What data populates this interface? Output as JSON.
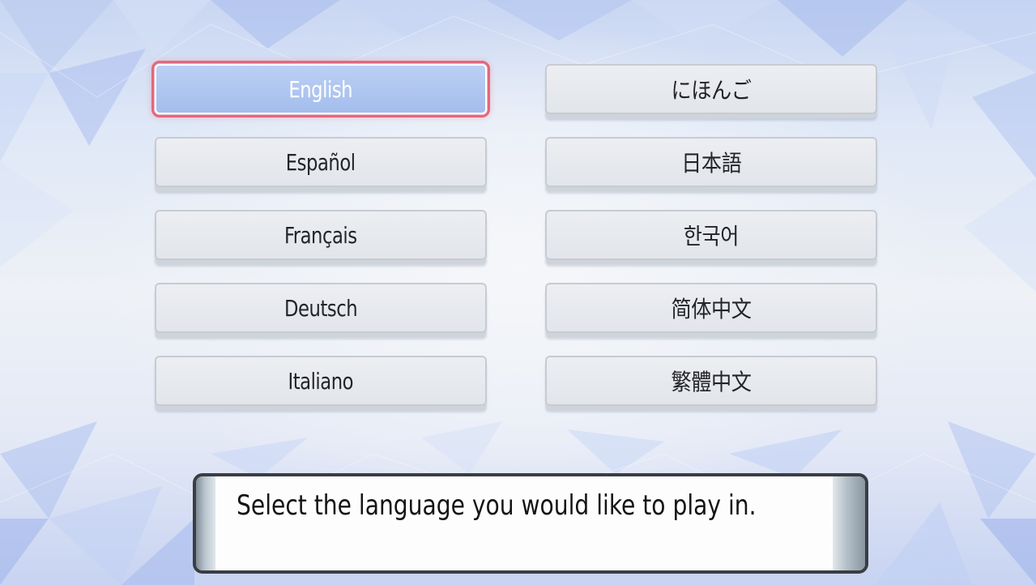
{
  "language_menu": {
    "left_column": [
      {
        "label": "English",
        "selected": true
      },
      {
        "label": "Español",
        "selected": false
      },
      {
        "label": "Français",
        "selected": false
      },
      {
        "label": "Deutsch",
        "selected": false
      },
      {
        "label": "Italiano",
        "selected": false
      }
    ],
    "right_column": [
      {
        "label": "にほんご",
        "selected": false
      },
      {
        "label": "日本語",
        "selected": false
      },
      {
        "label": "한국어",
        "selected": false
      },
      {
        "label": "简体中文",
        "selected": false
      },
      {
        "label": "繁體中文",
        "selected": false
      }
    ]
  },
  "dialog": {
    "message": "Select the language you would like to play in."
  },
  "colors": {
    "selected_fill": "#a4bdec",
    "selected_outline": "#e3677b",
    "button_fill": "#e2e5ea",
    "dialog_border": "#3a3d42"
  }
}
